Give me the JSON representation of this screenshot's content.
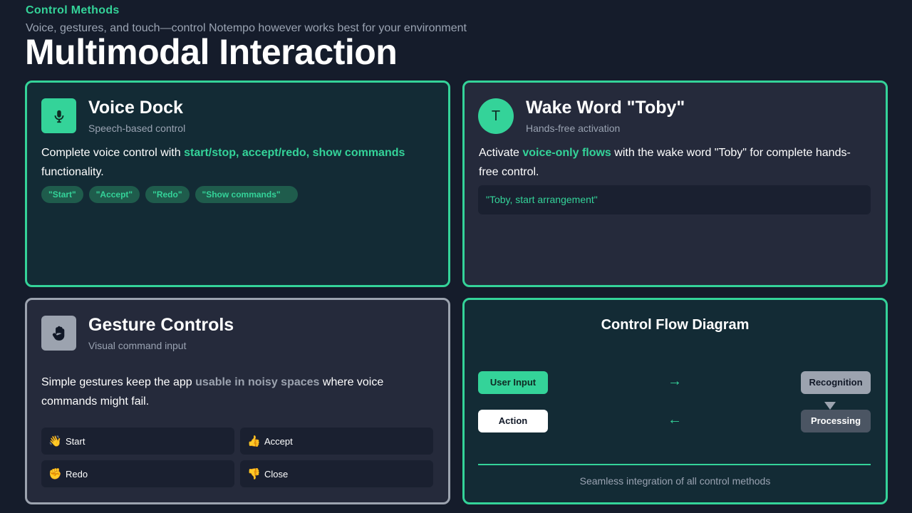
{
  "header": {
    "eyebrow": "Control Methods",
    "subtitle": "Voice, gestures, and touch—control Notempo however works best for your environment",
    "title": "Multimodal Interaction"
  },
  "voice_dock": {
    "title": "Voice Dock",
    "subtitle": "Speech-based control",
    "body_prefix": "Complete voice control with ",
    "body_highlight": "start/stop, accept/redo, show commands",
    "body_suffix": " functionality.",
    "commands": [
      "\"Start\"",
      "\"Accept\"",
      "\"Redo\"",
      "\"Show commands\""
    ],
    "icon": "microphone-icon"
  },
  "wake_word": {
    "title": "Wake Word \"Toby\"",
    "subtitle": "Hands-free activation",
    "icon_letter": "T",
    "body_prefix": "Activate ",
    "body_highlight": "voice-only flows",
    "body_suffix": " with the wake word \"Toby\" for complete hands-free control.",
    "example": "\"Toby, start arrangement\""
  },
  "gesture_controls": {
    "title": "Gesture Controls",
    "subtitle": "Visual command input",
    "body_prefix": "Simple gestures keep the app ",
    "body_highlight": "usable in noisy spaces",
    "body_suffix": " where voice commands might fail.",
    "icon": "hand-icon",
    "gestures": [
      {
        "emoji": "👋",
        "label": "Start",
        "icon": "wave-hand-icon"
      },
      {
        "emoji": "👍",
        "label": "Accept",
        "icon": "thumbs-up-icon"
      },
      {
        "emoji": "✊",
        "label": "Redo",
        "icon": "fist-icon"
      },
      {
        "emoji": "👎",
        "label": "Close",
        "icon": "thumbs-down-icon"
      }
    ]
  },
  "flow_diagram": {
    "title": "Control Flow Diagram",
    "user_input": "User Input",
    "recognition": "Recognition",
    "action": "Action",
    "processing": "Processing",
    "arrow_right": "→",
    "arrow_left": "←",
    "caption": "Seamless integration of all control methods"
  },
  "colors": {
    "accent": "#34d399",
    "background": "#151c2b",
    "card": "#252a3b",
    "card_teal": "#132b35",
    "muted": "#9ca3af"
  }
}
